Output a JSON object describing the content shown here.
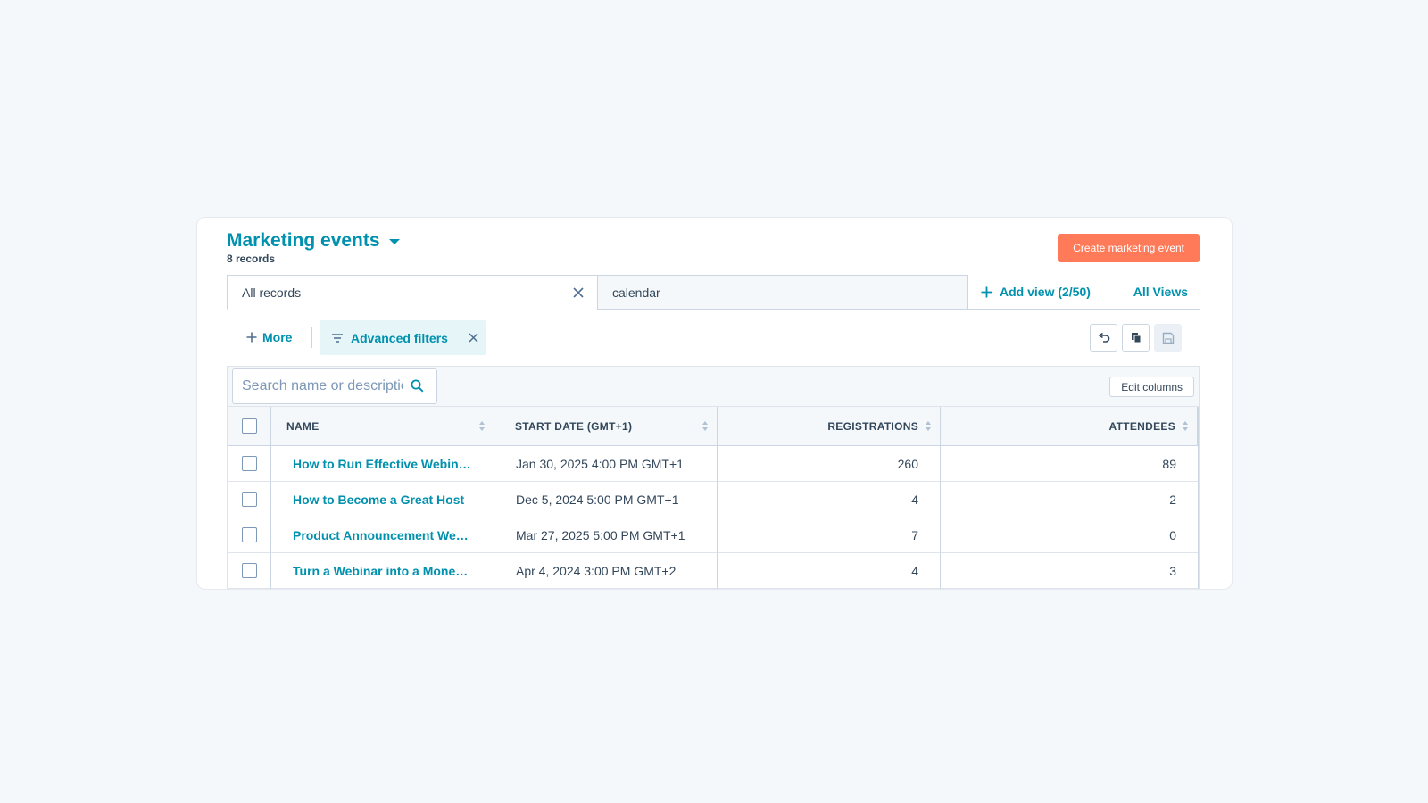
{
  "header": {
    "title": "Marketing events",
    "subtitle": "8 records",
    "create_button": "Create marketing event"
  },
  "views": {
    "tabs": [
      {
        "label": "All records",
        "active": true
      },
      {
        "label": "calendar",
        "active": false
      }
    ],
    "add_view": "Add view (2/50)",
    "all_views": "All Views"
  },
  "filters": {
    "more": "More",
    "advanced": "Advanced filters"
  },
  "toolbar": {
    "search_placeholder": "Search name or description",
    "edit_columns": "Edit columns",
    "icons": [
      "undo-icon",
      "copy-icon",
      "save-icon"
    ]
  },
  "table": {
    "columns": [
      "NAME",
      "START DATE (GMT+1)",
      "REGISTRATIONS",
      "ATTENDEES"
    ],
    "rows": [
      {
        "name": "How to Run Effective Webinars",
        "start": "Jan 30, 2025 4:00 PM GMT+1",
        "registrations": "260",
        "attendees": "89"
      },
      {
        "name": "How to Become a Great Host",
        "start": "Dec 5, 2024 5:00 PM GMT+1",
        "registrations": "4",
        "attendees": "2"
      },
      {
        "name": "Product Announcement Webinar",
        "start": "Mar 27, 2025 5:00 PM GMT+1",
        "registrations": "7",
        "attendees": "0"
      },
      {
        "name": "Turn a Webinar into a Money Maker",
        "start": "Apr 4, 2024 3:00 PM GMT+2",
        "registrations": "4",
        "attendees": "3"
      }
    ]
  },
  "colors": {
    "accent": "#0091ae",
    "primary_button": "#ff7a59",
    "text": "#33475b",
    "border": "#cbd6e2",
    "background": "#f5f8fa"
  }
}
